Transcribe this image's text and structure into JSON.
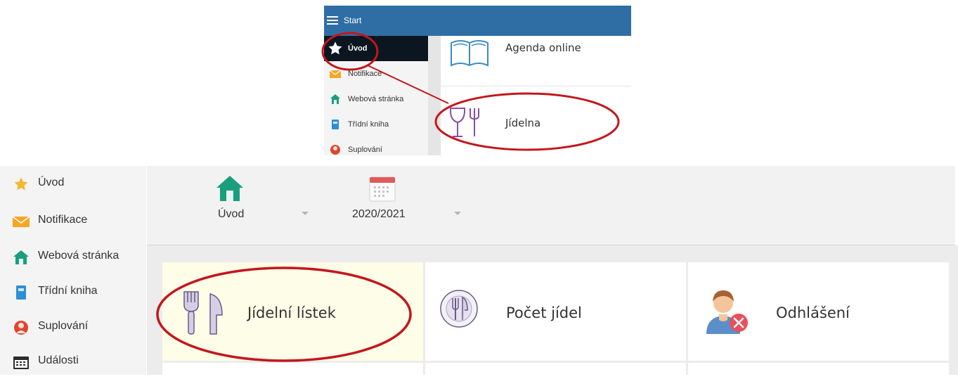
{
  "top_inset": {
    "header_title": "Start",
    "sidebar": [
      {
        "label": "Úvod",
        "icon": "star-icon",
        "active": true
      },
      {
        "label": "Notifikace",
        "icon": "envelope-icon"
      },
      {
        "label": "Webová stránka",
        "icon": "home-icon"
      },
      {
        "label": "Třídní kniha",
        "icon": "book-icon"
      },
      {
        "label": "Suplování",
        "icon": "person-icon"
      }
    ],
    "tiles": [
      {
        "label": "Agenda online",
        "icon": "open-book-icon"
      },
      {
        "label": "Jídelna",
        "icon": "glass-fork-icon"
      }
    ]
  },
  "bottom": {
    "sidebar": [
      {
        "label": "Úvod",
        "icon": "star-icon"
      },
      {
        "label": "Notifikace",
        "icon": "envelope-icon"
      },
      {
        "label": "Webová stránka",
        "icon": "home-icon"
      },
      {
        "label": "Třídní kniha",
        "icon": "book-icon"
      },
      {
        "label": "Suplování",
        "icon": "person-icon"
      },
      {
        "label": "Události",
        "icon": "calendar-icon"
      }
    ],
    "selectors": [
      {
        "label": "Úvod",
        "icon": "home-icon"
      },
      {
        "label": "2020/2021",
        "icon": "calendar-icon"
      }
    ],
    "tiles": [
      {
        "label": "Jídelní lístek",
        "icon": "utensils-icon",
        "highlighted": true
      },
      {
        "label": "Počet jídel",
        "icon": "plate-cutlery-icon"
      },
      {
        "label": "Odhlášení",
        "icon": "user-cancel-icon"
      }
    ]
  },
  "colors": {
    "header_blue": "#2f6ea4",
    "annotation_red": "#c4161c",
    "active_item": "#0b1620",
    "highlight_tile": "#fdfde8"
  }
}
